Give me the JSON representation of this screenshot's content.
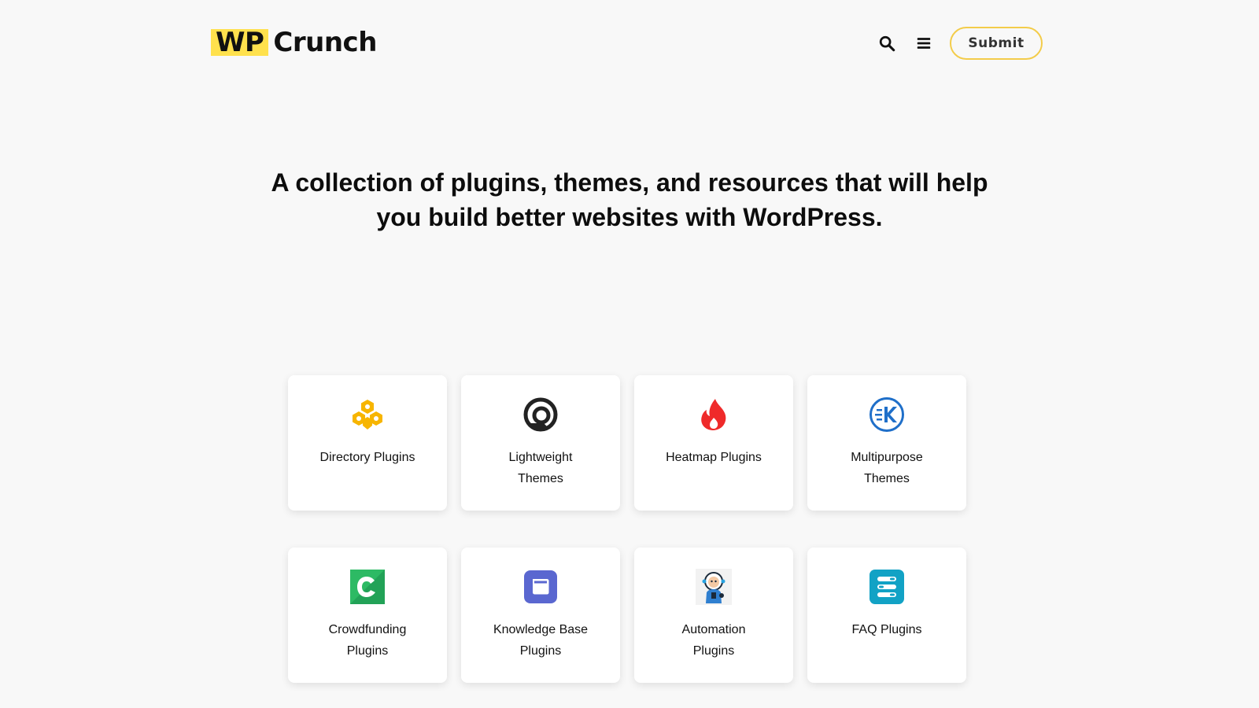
{
  "header": {
    "logo_prefix": "WP",
    "logo_name": "Crunch",
    "submit_label": "Submit"
  },
  "hero": {
    "headline": "A collection of plugins, themes, and resources that will help you build better websites with WordPress."
  },
  "colors": {
    "background": "#f8f8f8",
    "logo_highlight": "#ffe14d",
    "submit_border": "#f3cc4a"
  },
  "cards": [
    {
      "label": "Directory Plugins",
      "icon": "directory-icon"
    },
    {
      "label": "Lightweight Themes",
      "icon": "lightweight-icon"
    },
    {
      "label": "Heatmap Plugins",
      "icon": "flame-icon"
    },
    {
      "label": "Multipurpose Themes",
      "icon": "multipurpose-icon"
    },
    {
      "label": "Crowdfunding Plugins",
      "icon": "crowdfunding-icon"
    },
    {
      "label": "Knowledge Base Plugins",
      "icon": "knowledge-base-icon"
    },
    {
      "label": "Automation Plugins",
      "icon": "astronaut-icon"
    },
    {
      "label": "FAQ Plugins",
      "icon": "faq-icon"
    }
  ]
}
